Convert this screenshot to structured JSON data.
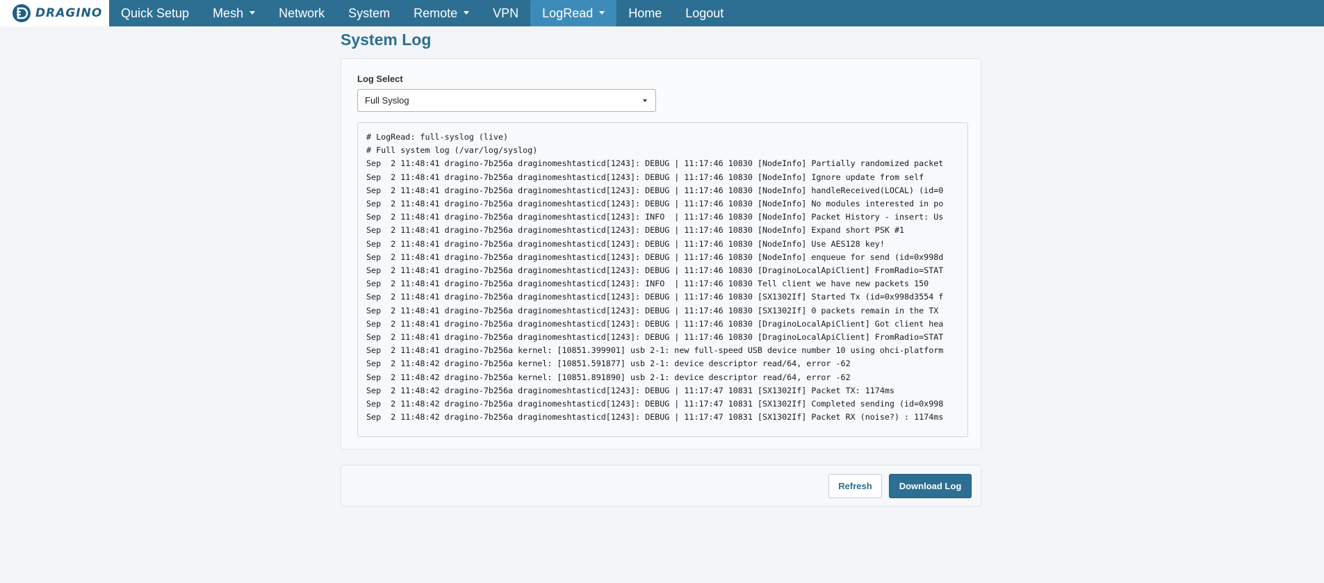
{
  "brand": {
    "logo_text": "DRAGINO"
  },
  "nav": {
    "items": [
      {
        "label": "Quick Setup",
        "dropdown": false,
        "active": false
      },
      {
        "label": "Mesh",
        "dropdown": true,
        "active": false
      },
      {
        "label": "Network",
        "dropdown": false,
        "active": false
      },
      {
        "label": "System",
        "dropdown": false,
        "active": false
      },
      {
        "label": "Remote",
        "dropdown": true,
        "active": false
      },
      {
        "label": "VPN",
        "dropdown": false,
        "active": false
      },
      {
        "label": "LogRead",
        "dropdown": true,
        "active": true
      },
      {
        "label": "Home",
        "dropdown": false,
        "active": false
      },
      {
        "label": "Logout",
        "dropdown": false,
        "active": false
      }
    ]
  },
  "page": {
    "title": "System Log"
  },
  "log_select": {
    "label": "Log Select",
    "value": "Full Syslog"
  },
  "log": {
    "lines": [
      "# LogRead: full-syslog (live)",
      "# Full system log (/var/log/syslog)",
      "Sep  2 11:48:41 dragino-7b256a draginomeshtasticd[1243]: DEBUG | 11:17:46 10830 [NodeInfo] Partially randomized packet",
      "Sep  2 11:48:41 dragino-7b256a draginomeshtasticd[1243]: DEBUG | 11:17:46 10830 [NodeInfo] Ignore update from self",
      "Sep  2 11:48:41 dragino-7b256a draginomeshtasticd[1243]: DEBUG | 11:17:46 10830 [NodeInfo] handleReceived(LOCAL) (id=0",
      "Sep  2 11:48:41 dragino-7b256a draginomeshtasticd[1243]: DEBUG | 11:17:46 10830 [NodeInfo] No modules interested in po",
      "Sep  2 11:48:41 dragino-7b256a draginomeshtasticd[1243]: INFO  | 11:17:46 10830 [NodeInfo] Packet History - insert: Us",
      "Sep  2 11:48:41 dragino-7b256a draginomeshtasticd[1243]: DEBUG | 11:17:46 10830 [NodeInfo] Expand short PSK #1",
      "Sep  2 11:48:41 dragino-7b256a draginomeshtasticd[1243]: DEBUG | 11:17:46 10830 [NodeInfo] Use AES128 key!",
      "Sep  2 11:48:41 dragino-7b256a draginomeshtasticd[1243]: DEBUG | 11:17:46 10830 [NodeInfo] enqueue for send (id=0x998d",
      "Sep  2 11:48:41 dragino-7b256a draginomeshtasticd[1243]: DEBUG | 11:17:46 10830 [DraginoLocalApiClient] FromRadio=STAT",
      "Sep  2 11:48:41 dragino-7b256a draginomeshtasticd[1243]: INFO  | 11:17:46 10830 Tell client we have new packets 150",
      "Sep  2 11:48:41 dragino-7b256a draginomeshtasticd[1243]: DEBUG | 11:17:46 10830 [SX1302If] Started Tx (id=0x998d3554 f",
      "Sep  2 11:48:41 dragino-7b256a draginomeshtasticd[1243]: DEBUG | 11:17:46 10830 [SX1302If] 0 packets remain in the TX",
      "Sep  2 11:48:41 dragino-7b256a draginomeshtasticd[1243]: DEBUG | 11:17:46 10830 [DraginoLocalApiClient] Got client hea",
      "Sep  2 11:48:41 dragino-7b256a draginomeshtasticd[1243]: DEBUG | 11:17:46 10830 [DraginoLocalApiClient] FromRadio=STAT",
      "Sep  2 11:48:41 dragino-7b256a kernel: [10851.399901] usb 2-1: new full-speed USB device number 10 using ohci-platform",
      "Sep  2 11:48:42 dragino-7b256a kernel: [10851.591877] usb 2-1: device descriptor read/64, error -62",
      "Sep  2 11:48:42 dragino-7b256a kernel: [10851.891890] usb 2-1: device descriptor read/64, error -62",
      "Sep  2 11:48:42 dragino-7b256a draginomeshtasticd[1243]: DEBUG | 11:17:47 10831 [SX1302If] Packet TX: 1174ms",
      "Sep  2 11:48:42 dragino-7b256a draginomeshtasticd[1243]: DEBUG | 11:17:47 10831 [SX1302If] Completed sending (id=0x998",
      "Sep  2 11:48:42 dragino-7b256a draginomeshtasticd[1243]: DEBUG | 11:17:47 10831 [SX1302If] Packet RX (noise?) : 1174ms"
    ]
  },
  "actions": {
    "refresh_label": "Refresh",
    "download_label": "Download Log"
  },
  "colors": {
    "nav_bg": "#2d6f93",
    "nav_active": "#3d8bb8",
    "accent": "#2d6f93"
  }
}
